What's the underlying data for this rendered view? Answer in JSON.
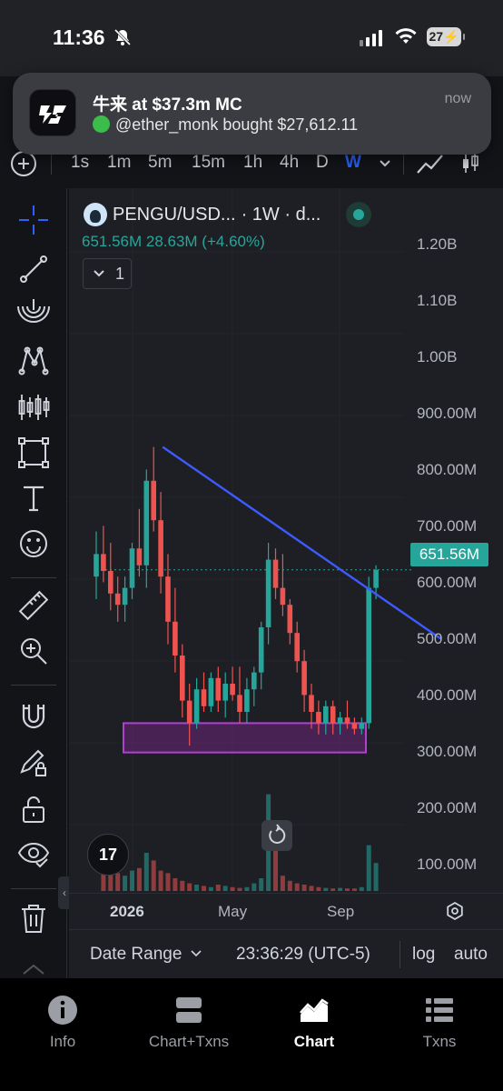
{
  "status_bar": {
    "time": "11:36",
    "battery": "27"
  },
  "notification": {
    "title": "牛来 at $37.3m MC",
    "body": "@ether_monk bought $27,612.11",
    "time": "now"
  },
  "timeframes": {
    "items": [
      "1s",
      "1m",
      "5m",
      "15m",
      "1h",
      "4h",
      "D",
      "W"
    ],
    "active": "W"
  },
  "left_toolbar": {
    "tools": [
      "crosshair-icon",
      "trend-line-icon",
      "fib-icon",
      "pattern-icon",
      "forecast-icon",
      "rectangle-icon",
      "text-icon",
      "emoji-icon",
      "ruler-icon",
      "zoom-in-icon",
      "magnet-icon",
      "lock-drawing-icon",
      "unlock-icon",
      "eye-icon",
      "trash-icon"
    ]
  },
  "legend": {
    "symbol": "PENGU/USD...",
    "interval": "· 1W · d...",
    "values": "651.56M  28.63M (+4.60%)",
    "indicator_count": "1"
  },
  "price_axis": {
    "labels": [
      "1.20B",
      "1.10B",
      "1.00B",
      "900.00M",
      "800.00M",
      "700.00M",
      "600.00M",
      "500.00M",
      "400.00M",
      "300.00M",
      "200.00M",
      "100.00M"
    ],
    "last_price": "651.56M"
  },
  "time_axis": {
    "labels": [
      "2026",
      "May",
      "Sep"
    ]
  },
  "bottom_controls": {
    "date_range": "Date Range",
    "clock": "23:36:29 (UTC-5)",
    "log": "log",
    "auto": "auto"
  },
  "tv_logo_text": "17",
  "colors": {
    "up": "#26a69a",
    "down": "#ef5350",
    "trendline": "#3d5afe",
    "zone": "#9c27b0",
    "accent": "#2962ff"
  },
  "chart_data": {
    "type": "candlestick",
    "interval": "1W",
    "ylim": [
      250000000,
      1250000000
    ],
    "candles": [
      [
        640,
        720,
        600,
        680
      ],
      [
        680,
        730,
        630,
        650
      ],
      [
        650,
        700,
        580,
        610
      ],
      [
        610,
        640,
        560,
        590
      ],
      [
        590,
        640,
        560,
        620
      ],
      [
        620,
        700,
        600,
        690
      ],
      [
        690,
        760,
        640,
        660
      ],
      [
        660,
        830,
        620,
        810
      ],
      [
        810,
        870,
        720,
        740
      ],
      [
        740,
        790,
        610,
        640
      ],
      [
        640,
        680,
        520,
        560
      ],
      [
        560,
        620,
        470,
        500
      ],
      [
        500,
        520,
        390,
        420
      ],
      [
        420,
        450,
        340,
        380
      ],
      [
        380,
        460,
        370,
        440
      ],
      [
        440,
        470,
        400,
        410
      ],
      [
        410,
        470,
        400,
        460
      ],
      [
        460,
        480,
        400,
        420
      ],
      [
        420,
        470,
        390,
        450
      ],
      [
        450,
        480,
        420,
        430
      ],
      [
        430,
        480,
        380,
        400
      ],
      [
        400,
        460,
        380,
        440
      ],
      [
        440,
        480,
        410,
        470
      ],
      [
        470,
        560,
        440,
        550
      ],
      [
        550,
        700,
        520,
        670
      ],
      [
        670,
        690,
        600,
        620
      ],
      [
        620,
        680,
        570,
        590
      ],
      [
        590,
        600,
        520,
        540
      ],
      [
        540,
        560,
        470,
        490
      ],
      [
        490,
        510,
        400,
        430
      ],
      [
        430,
        450,
        370,
        400
      ],
      [
        400,
        420,
        360,
        380
      ],
      [
        380,
        420,
        360,
        410
      ],
      [
        410,
        420,
        360,
        380
      ],
      [
        380,
        400,
        360,
        390
      ],
      [
        390,
        420,
        370,
        380
      ],
      [
        380,
        390,
        360,
        370
      ],
      [
        370,
        390,
        360,
        380
      ],
      [
        380,
        640,
        370,
        620
      ],
      [
        620,
        660,
        600,
        652
      ]
    ],
    "volume": [
      0,
      150,
      110,
      70,
      60,
      80,
      90,
      150,
      120,
      80,
      70,
      50,
      40,
      30,
      25,
      20,
      15,
      25,
      20,
      15,
      12,
      15,
      30,
      50,
      380,
      170,
      60,
      40,
      30,
      25,
      20,
      15,
      12,
      10,
      12,
      10,
      10,
      15,
      180,
      110
    ],
    "trendline": {
      "start_week": 8,
      "start_price": 870000000,
      "end_week": 48,
      "end_price": 530000000
    },
    "support_zone": {
      "top": 380000000,
      "bottom": 328000000
    }
  }
}
